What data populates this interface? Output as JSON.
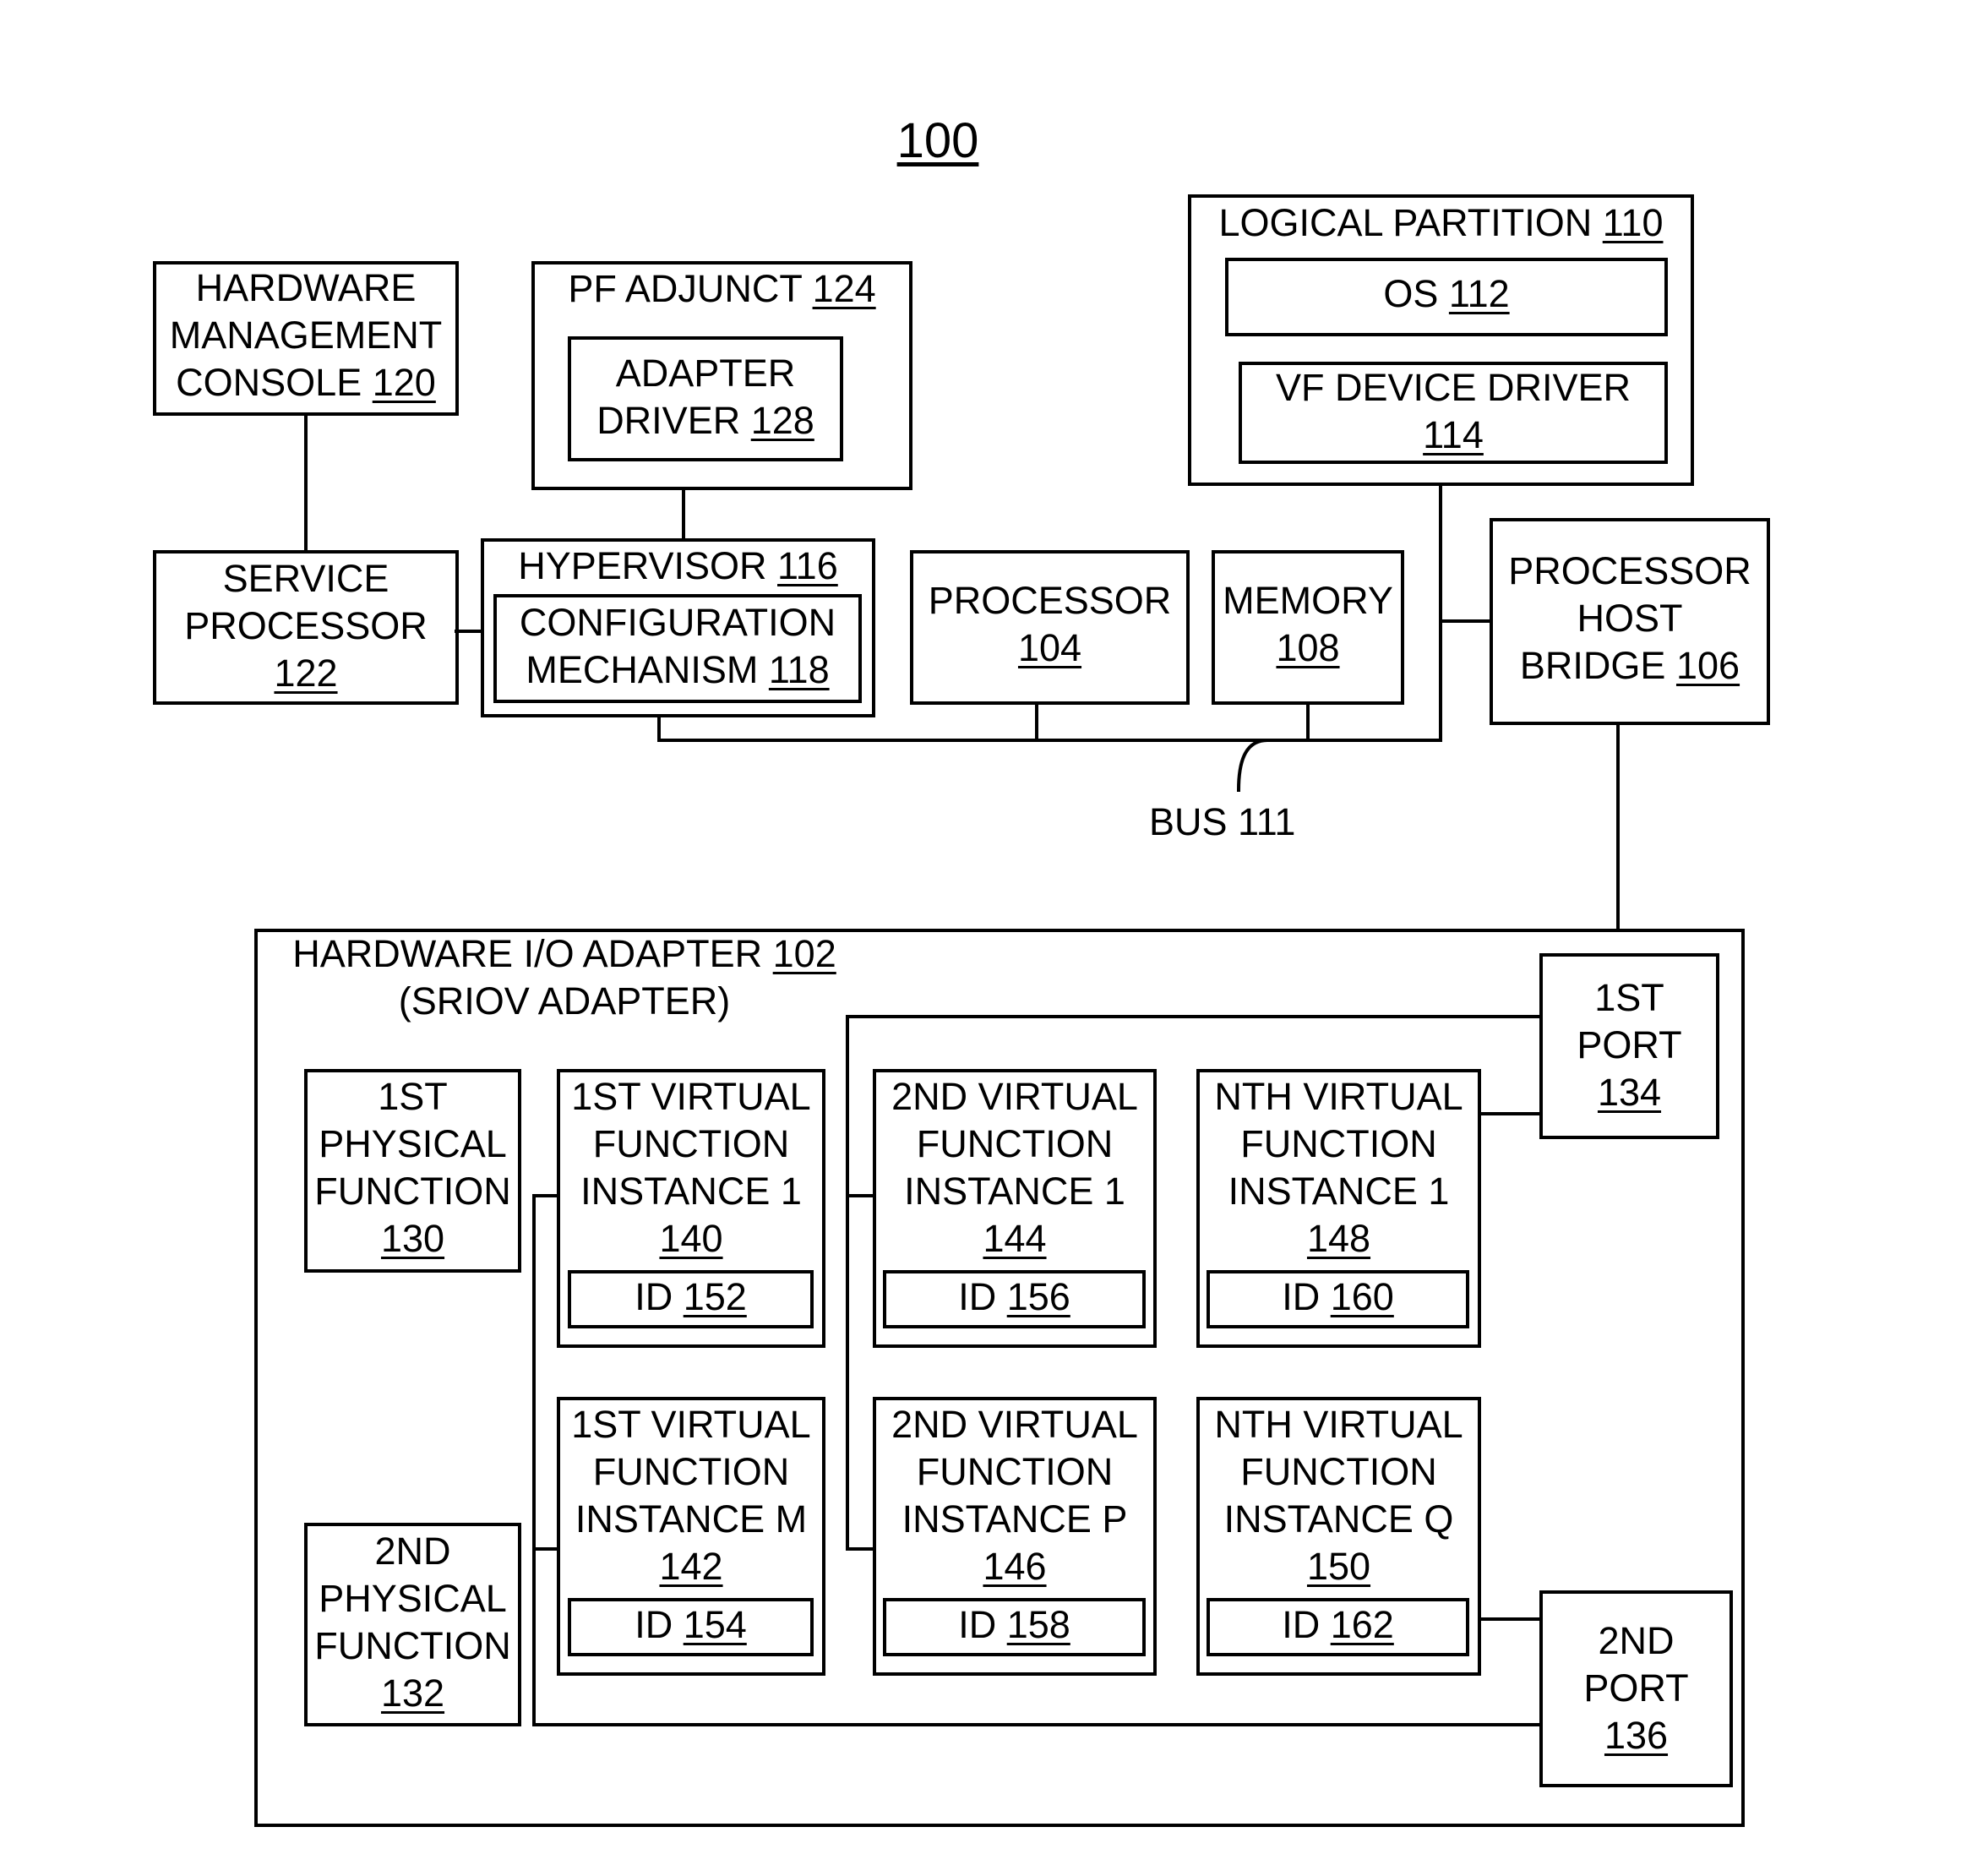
{
  "figure_number": "100",
  "bus_label": "BUS 111",
  "boxes": {
    "hmc": {
      "lines": [
        "HARDWARE",
        "MANAGEMENT"
      ],
      "last_text": "CONSOLE ",
      "ref": "120"
    },
    "pf_adjunct": {
      "lines": [],
      "last_text": "PF ADJUNCT ",
      "ref": "124"
    },
    "adapter_driver": {
      "lines": [
        "ADAPTER"
      ],
      "last_text": "DRIVER ",
      "ref": "128"
    },
    "logical_partition": {
      "lines": [],
      "last_text": "LOGICAL PARTITION ",
      "ref": "110"
    },
    "os": {
      "lines": [],
      "last_text": "OS ",
      "ref": "112"
    },
    "vf_device_driver": {
      "lines": [
        "VF DEVICE DRIVER"
      ],
      "last_text": "",
      "ref": "114"
    },
    "service_processor": {
      "lines": [
        "SERVICE",
        "PROCESSOR"
      ],
      "last_text": "",
      "ref": "122"
    },
    "hypervisor": {
      "lines": [],
      "last_text": "HYPERVISOR ",
      "ref": "116"
    },
    "config_mechanism": {
      "lines": [
        "CONFIGURATION"
      ],
      "last_text": "MECHANISM ",
      "ref": "118"
    },
    "processor": {
      "lines": [
        "PROCESSOR"
      ],
      "last_text": "",
      "ref": "104"
    },
    "memory": {
      "lines": [
        "MEMORY"
      ],
      "last_text": "",
      "ref": "108"
    },
    "phb": {
      "lines": [
        "PROCESSOR",
        "HOST"
      ],
      "last_text": "BRIDGE ",
      "ref": "106"
    },
    "io_adapter": {
      "lines": [],
      "last_text": "HARDWARE I/O ADAPTER ",
      "ref": "102",
      "subtitle": "(SRIOV ADAPTER)"
    },
    "port1": {
      "lines": [
        "1ST",
        "PORT"
      ],
      "last_text": "",
      "ref": "134"
    },
    "port2": {
      "lines": [
        "2ND",
        "PORT"
      ],
      "last_text": "",
      "ref": "136"
    },
    "pf1": {
      "lines": [
        "1ST",
        "PHYSICAL",
        "FUNCTION"
      ],
      "last_text": "",
      "ref": "130"
    },
    "pf2": {
      "lines": [
        "2ND",
        "PHYSICAL",
        "FUNCTION"
      ],
      "last_text": "",
      "ref": "132"
    },
    "vf_1_1": {
      "lines": [
        "1ST VIRTUAL",
        "FUNCTION",
        "INSTANCE 1"
      ],
      "last_text": "",
      "ref": "140"
    },
    "id_152": {
      "lines": [],
      "last_text": "ID ",
      "ref": "152"
    },
    "vf_2_1": {
      "lines": [
        "2ND VIRTUAL",
        "FUNCTION",
        "INSTANCE 1"
      ],
      "last_text": "",
      "ref": "144"
    },
    "id_156": {
      "lines": [],
      "last_text": "ID ",
      "ref": "156"
    },
    "vf_n_1": {
      "lines": [
        "NTH VIRTUAL",
        "FUNCTION",
        "INSTANCE 1"
      ],
      "last_text": "",
      "ref": "148"
    },
    "id_160": {
      "lines": [],
      "last_text": "ID ",
      "ref": "160"
    },
    "vf_1_m": {
      "lines": [
        "1ST VIRTUAL",
        "FUNCTION",
        "INSTANCE M"
      ],
      "last_text": "",
      "ref": "142"
    },
    "id_154": {
      "lines": [],
      "last_text": "ID ",
      "ref": "154"
    },
    "vf_2_p": {
      "lines": [
        "2ND VIRTUAL",
        "FUNCTION",
        "INSTANCE P"
      ],
      "last_text": "",
      "ref": "146"
    },
    "id_158": {
      "lines": [],
      "last_text": "ID ",
      "ref": "158"
    },
    "vf_n_q": {
      "lines": [
        "NTH VIRTUAL",
        "FUNCTION",
        "INSTANCE Q"
      ],
      "last_text": "",
      "ref": "150"
    },
    "id_162": {
      "lines": [],
      "last_text": "ID ",
      "ref": "162"
    }
  }
}
